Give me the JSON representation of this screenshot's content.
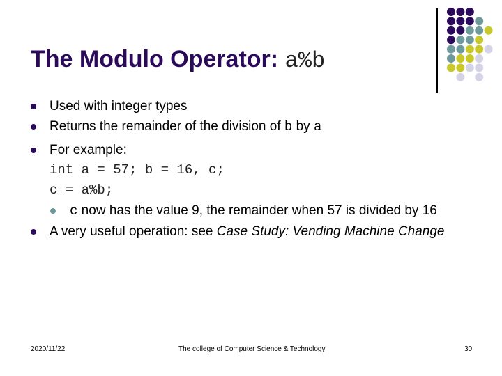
{
  "slide": {
    "title_text": "The Modulo Operator: ",
    "title_code": "a%b",
    "bullets": {
      "b1": "Used with integer types",
      "b2_pre": "Returns the remainder of the division of ",
      "b2_code1": "b",
      "b2_mid": " by ",
      "b2_code2": "a",
      "b3": "For example:",
      "code1": "int a = 57; b = 16, c;",
      "code2": "c = a%b;",
      "sub_code": "c",
      "sub_text": " now has the value 9, the remainder when 57 is divided by 16",
      "b4_pre": "A very useful operation: see ",
      "b4_italic": "Case Study: Vending Machine Change"
    }
  },
  "footer": {
    "date": "2020/11/22",
    "center": "The college of Computer Science & Technology",
    "page": "30"
  },
  "decoration": {
    "colors": {
      "purple": "#2b0a5c",
      "teal": "#6e9a9b",
      "yellow": "#c8c82a",
      "lavender": "#d4d4e6"
    },
    "grid": [
      [
        "purple",
        "purple",
        "purple",
        "",
        ""
      ],
      [
        "purple",
        "purple",
        "purple",
        "teal",
        ""
      ],
      [
        "purple",
        "purple",
        "teal",
        "teal",
        "yellow"
      ],
      [
        "purple",
        "teal",
        "teal",
        "yellow",
        ""
      ],
      [
        "teal",
        "teal",
        "yellow",
        "yellow",
        "lavender"
      ],
      [
        "teal",
        "yellow",
        "yellow",
        "lavender",
        ""
      ],
      [
        "yellow",
        "yellow",
        "lavender",
        "lavender",
        ""
      ],
      [
        "",
        "lavender",
        "",
        "lavender",
        ""
      ]
    ]
  }
}
